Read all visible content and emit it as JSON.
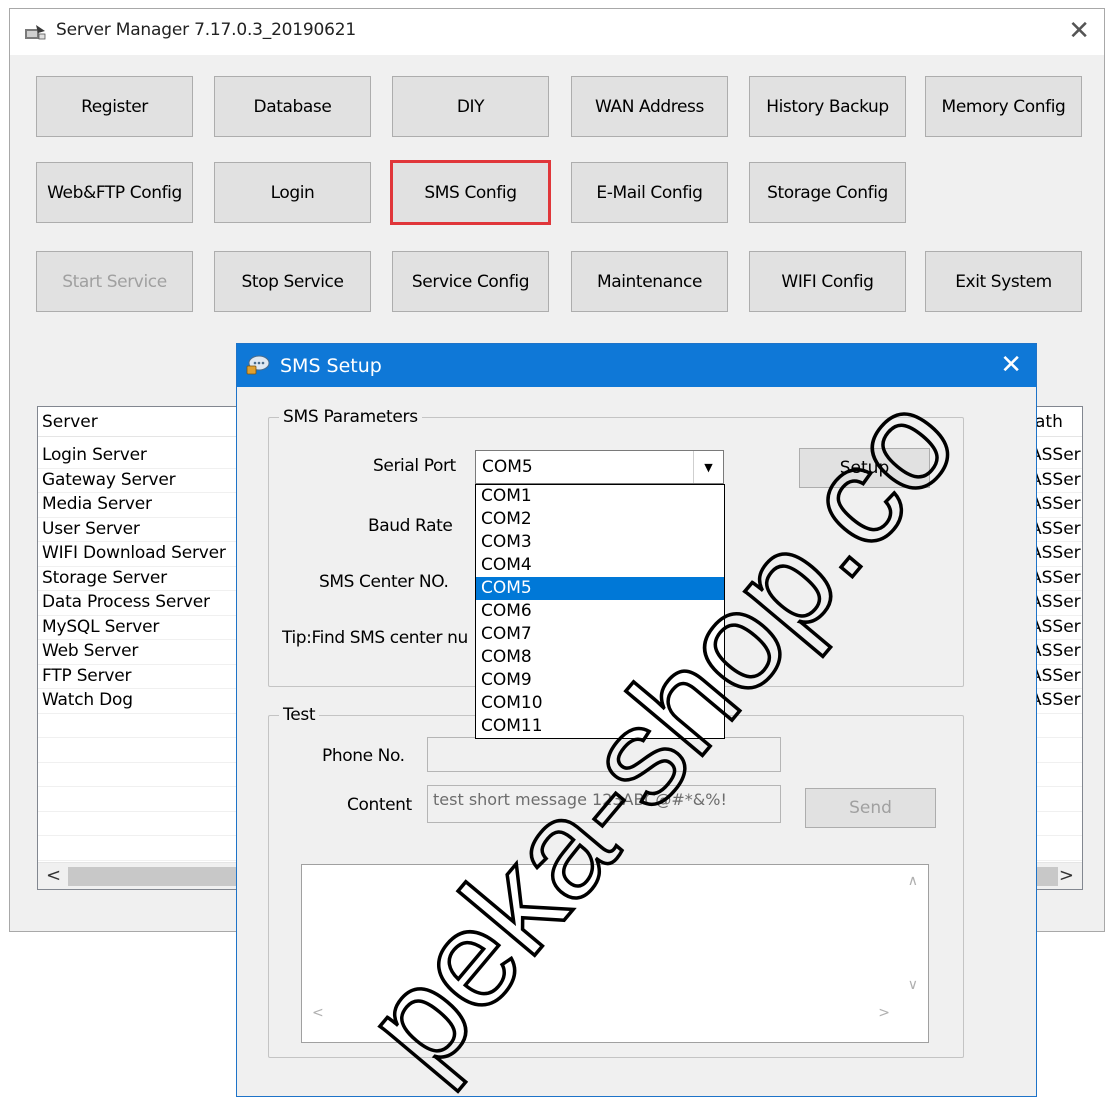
{
  "main_window": {
    "title": "Server Manager 7.17.0.3_20190621",
    "close_glyph": "✕",
    "buttons": [
      {
        "label": "Register"
      },
      {
        "label": "Database"
      },
      {
        "label": "DIY"
      },
      {
        "label": "WAN Address"
      },
      {
        "label": "History Backup"
      },
      {
        "label": "Memory Config"
      },
      {
        "label": "Web&FTP Config"
      },
      {
        "label": "Login"
      },
      {
        "label": "SMS Config",
        "highlighted": true
      },
      {
        "label": "E-Mail Config"
      },
      {
        "label": "Storage Config"
      },
      {
        "label": "Start Service",
        "disabled": true
      },
      {
        "label": "Stop Service"
      },
      {
        "label": "Service Config"
      },
      {
        "label": "Maintenance"
      },
      {
        "label": "WIFI Config"
      },
      {
        "label": "Exit System"
      }
    ],
    "server_list": {
      "columns": [
        "Server",
        "ath"
      ],
      "rows": [
        {
          "name": "Login Server",
          "path": "ASSer"
        },
        {
          "name": "Gateway Server",
          "path": "ASSer"
        },
        {
          "name": "Media Server",
          "path": "ASSer"
        },
        {
          "name": "User Server",
          "path": "ASSer"
        },
        {
          "name": "WIFI Download Server",
          "path": "ASSer"
        },
        {
          "name": "Storage Server",
          "path": "ASSer"
        },
        {
          "name": "Data Process Server",
          "path": "ASSer"
        },
        {
          "name": "MySQL Server",
          "path": "ASSer"
        },
        {
          "name": "Web Server",
          "path": "ASSer"
        },
        {
          "name": "FTP Server",
          "path": "ASSer"
        },
        {
          "name": "Watch Dog",
          "path": "ASSer"
        }
      ],
      "scroll_left": "<",
      "scroll_right": ">"
    }
  },
  "sms_dialog": {
    "title": "SMS Setup",
    "close_glyph": "✕",
    "params_group": {
      "label": "SMS Parameters",
      "serial_port_label": "Serial Port",
      "serial_port_value": "COM5",
      "baud_rate_label": "Baud Rate",
      "center_no_label": "SMS Center NO.",
      "tip": "Tip:Find SMS center nu",
      "setup_button": "Setup",
      "dropdown_options": [
        "COM1",
        "COM2",
        "COM3",
        "COM4",
        "COM5",
        "COM6",
        "COM7",
        "COM8",
        "COM9",
        "COM10",
        "COM11"
      ],
      "dropdown_selected": "COM5"
    },
    "test_group": {
      "label": "Test",
      "phone_label": "Phone No.",
      "phone_value": "",
      "content_label": "Content",
      "content_value": "test short message 123ABC@#*&%!",
      "send_button": "Send"
    }
  },
  "watermark": {
    "text": "peka-shop.co"
  },
  "colors": {
    "accent": "#0078d7",
    "highlight_border": "#e0363a",
    "window_bg": "#f0f0f0"
  }
}
